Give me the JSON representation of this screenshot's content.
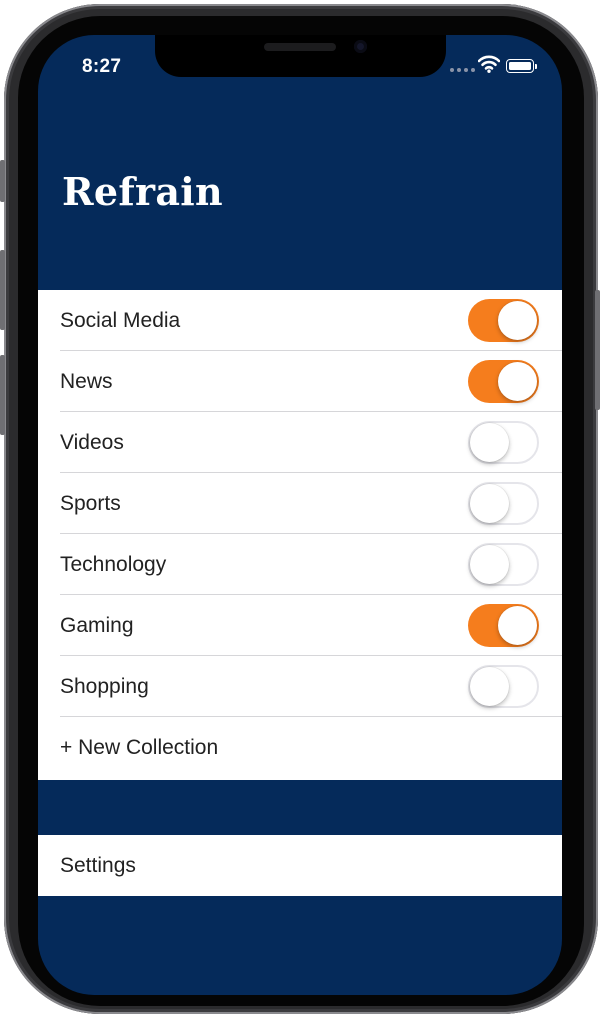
{
  "status_bar": {
    "time": "8:27"
  },
  "header": {
    "title": "Refrain"
  },
  "collections": [
    {
      "label": "Social Media",
      "enabled": true
    },
    {
      "label": "News",
      "enabled": true
    },
    {
      "label": "Videos",
      "enabled": false
    },
    {
      "label": "Sports",
      "enabled": false
    },
    {
      "label": "Technology",
      "enabled": false
    },
    {
      "label": "Gaming",
      "enabled": true
    },
    {
      "label": "Shopping",
      "enabled": false
    }
  ],
  "new_collection_label": "+ New Collection",
  "settings_label": "Settings",
  "colors": {
    "header_background": "#052a5a",
    "toggle_on": "#f57d1d",
    "toggle_off_border": "#e5e5ea"
  },
  "icons": [
    "wifi-icon",
    "battery-icon",
    "cellular-signal-icon"
  ]
}
